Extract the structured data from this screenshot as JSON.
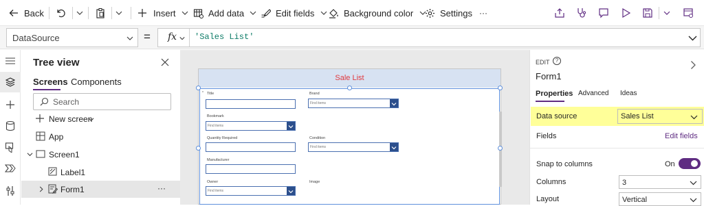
{
  "command_bar": {
    "back_label": "Back",
    "insert_label": "Insert",
    "add_data_label": "Add data",
    "edit_fields_label": "Edit fields",
    "background_color_label": "Background color",
    "settings_label": "Settings",
    "more_label": "···"
  },
  "formula_bar": {
    "property": "DataSource",
    "equals": "=",
    "fx_label": "fx",
    "formula": "'Sales List'"
  },
  "tree_view": {
    "title": "Tree view",
    "tabs": [
      "Screens",
      "Components"
    ],
    "search_placeholder": "Search",
    "new_screen_label": "New screen",
    "items": [
      {
        "label": "App"
      },
      {
        "label": "Screen1"
      },
      {
        "label": "Label1"
      },
      {
        "label": "Form1"
      }
    ],
    "row_more": "···"
  },
  "canvas": {
    "header_title": "Sale List",
    "fields": {
      "title": "Title",
      "brand": "Brand",
      "bookmark": "Bookmark",
      "quantity": "Quantity Required",
      "condition": "Condition",
      "manufacturer": "Manufacturer",
      "owner": "Owner",
      "image": "Image"
    },
    "dropdown_placeholder": "Find items"
  },
  "properties_panel": {
    "mode": "EDIT",
    "control_name": "Form1",
    "tabs": [
      "Properties",
      "Advanced",
      "Ideas"
    ],
    "data_source_label": "Data source",
    "data_source_value": "Sales List",
    "fields_label": "Fields",
    "edit_fields_link": "Edit fields",
    "snap_label": "Snap to columns",
    "snap_state": "On",
    "columns_label": "Columns",
    "columns_value": "3",
    "layout_label": "Layout",
    "layout_value": "Vertical",
    "help_glyph": "?"
  },
  "colors": {
    "accent": "#5f2c82",
    "highlight": "#ffff99",
    "form_border": "#5d8fdc",
    "header_fill": "#d7e2f2",
    "header_text": "#e0393e"
  },
  "icons": [
    "back-arrow-icon",
    "undo-icon",
    "paste-icon",
    "plus-icon",
    "database-icon",
    "edit-fields-icon",
    "paint-bucket-icon",
    "gear-icon",
    "share-icon",
    "stethoscope-icon",
    "comment-icon",
    "play-icon",
    "save-icon",
    "publish-icon",
    "hamburger-icon",
    "layers-icon",
    "cylinder-icon",
    "media-icon",
    "flow-icon",
    "tools-icon",
    "close-icon",
    "search-icon",
    "chevron-right-icon"
  ]
}
